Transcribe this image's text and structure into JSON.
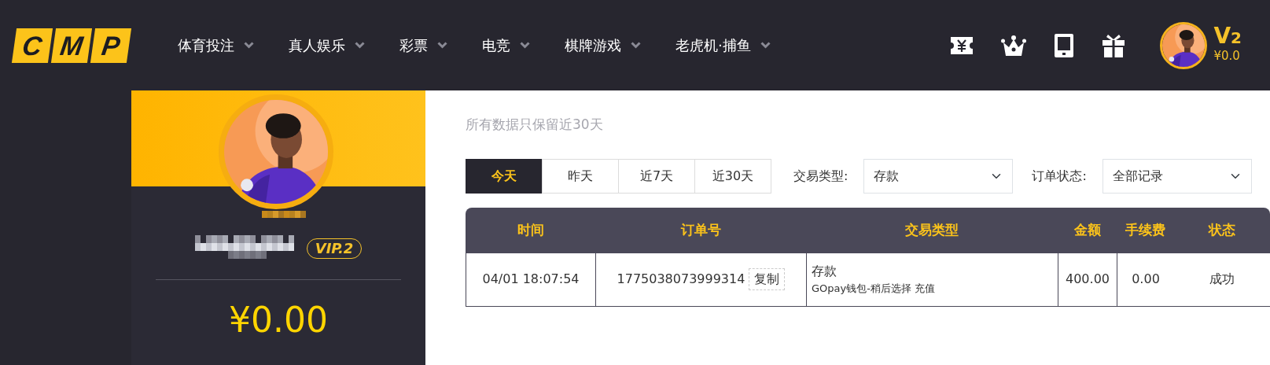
{
  "header": {
    "logo": [
      "C",
      "M",
      "P"
    ],
    "nav": [
      {
        "label": "体育投注"
      },
      {
        "label": "真人娱乐"
      },
      {
        "label": "彩票"
      },
      {
        "label": "电竞"
      },
      {
        "label": "棋牌游戏"
      },
      {
        "label": "老虎机·捕鱼"
      }
    ],
    "user": {
      "level": "V",
      "level_number": "2",
      "balance": "¥0.0"
    }
  },
  "profile": {
    "vip": "VIP.2",
    "balance": "¥0.00"
  },
  "main": {
    "subtitle": "所有数据只保留近30天",
    "date_tabs": [
      {
        "label": "今天",
        "selected": true
      },
      {
        "label": "昨天",
        "selected": false
      },
      {
        "label": "近7天",
        "selected": false
      },
      {
        "label": "近30天",
        "selected": false
      }
    ],
    "filters": [
      {
        "label": "交易类型:",
        "value": "存款"
      },
      {
        "label": "订单状态:",
        "value": "全部记录"
      }
    ],
    "table": {
      "columns": [
        "时间",
        "订单号",
        "交易类型",
        "金额",
        "手续费",
        "状态"
      ],
      "rows": [
        {
          "time": "04/01 18:07:54",
          "order_no": "1775038073999314",
          "copy": "复制",
          "type": "存款",
          "detail": "GOpay钱包-稍后选择 充值",
          "amount": "400.00",
          "fee": "0.00",
          "status": "成功"
        }
      ]
    }
  }
}
